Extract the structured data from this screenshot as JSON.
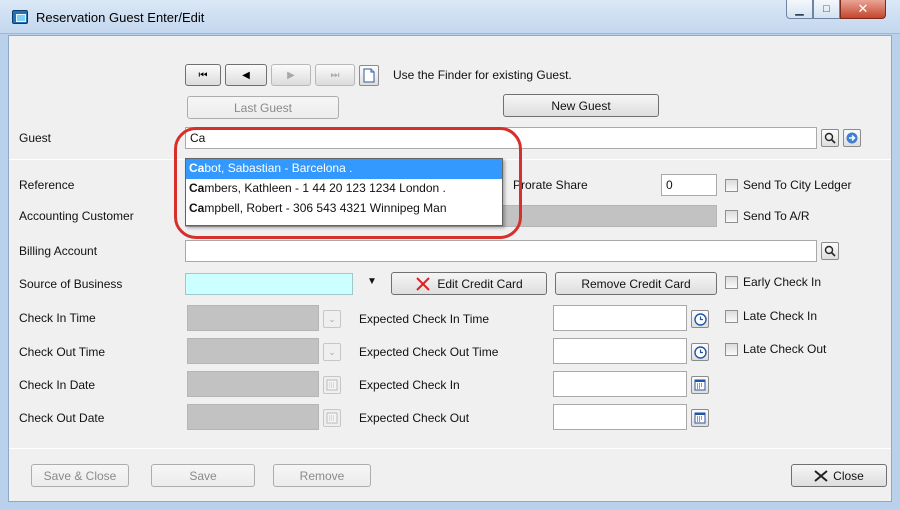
{
  "window": {
    "title": "Reservation Guest Enter/Edit"
  },
  "navigator": {
    "first": "⏮",
    "prev": "◀",
    "next": "▶",
    "last": "⏭",
    "finder_hint": "Use the Finder for existing Guest."
  },
  "buttons": {
    "last_guest": "Last Guest",
    "new_guest": "New Guest",
    "edit_credit_card": "Edit Credit Card",
    "remove_credit_card": "Remove Credit Card",
    "save_close": "Save & Close",
    "save": "Save",
    "remove": "Remove",
    "close": "Close"
  },
  "labels": {
    "guest": "Guest",
    "reference": "Reference",
    "accounting_customer": "Accounting Customer",
    "billing_account": "Billing Account",
    "source_of_business": "Source of Business",
    "check_in_time": "Check In Time",
    "check_out_time": "Check Out Time",
    "check_in_date": "Check In Date",
    "check_out_date": "Check Out Date",
    "expected_check_in_time": "Expected Check In Time",
    "expected_check_out_time": "Expected Check Out Time",
    "expected_check_in": "Expected Check In",
    "expected_check_out": "Expected Check Out",
    "prorate_share": "Prorate Share"
  },
  "fields": {
    "guest_value": "Ca",
    "prorate_share_value": "0"
  },
  "checkboxes": {
    "send_to_city_ledger": "Send To City Ledger",
    "send_to_ar": "Send To A/R",
    "early_check_in": "Early Check In",
    "late_check_in": "Late Check In",
    "late_check_out": "Late Check Out"
  },
  "autocomplete": {
    "items": [
      {
        "match": "Ca",
        "rest": "bot, Sabastian -  Barcelona ."
      },
      {
        "match": "Ca",
        "rest": "mbers, Kathleen - 1 44 20 123 1234 London ."
      },
      {
        "match": "Ca",
        "rest": "mpbell, Robert - 306 543 4321 Winnipeg Man"
      }
    ]
  },
  "colors": {
    "source_of_business_fill": "#ccffff",
    "selected_item": "#3399ff",
    "highlight_ring": "#d6302c"
  }
}
